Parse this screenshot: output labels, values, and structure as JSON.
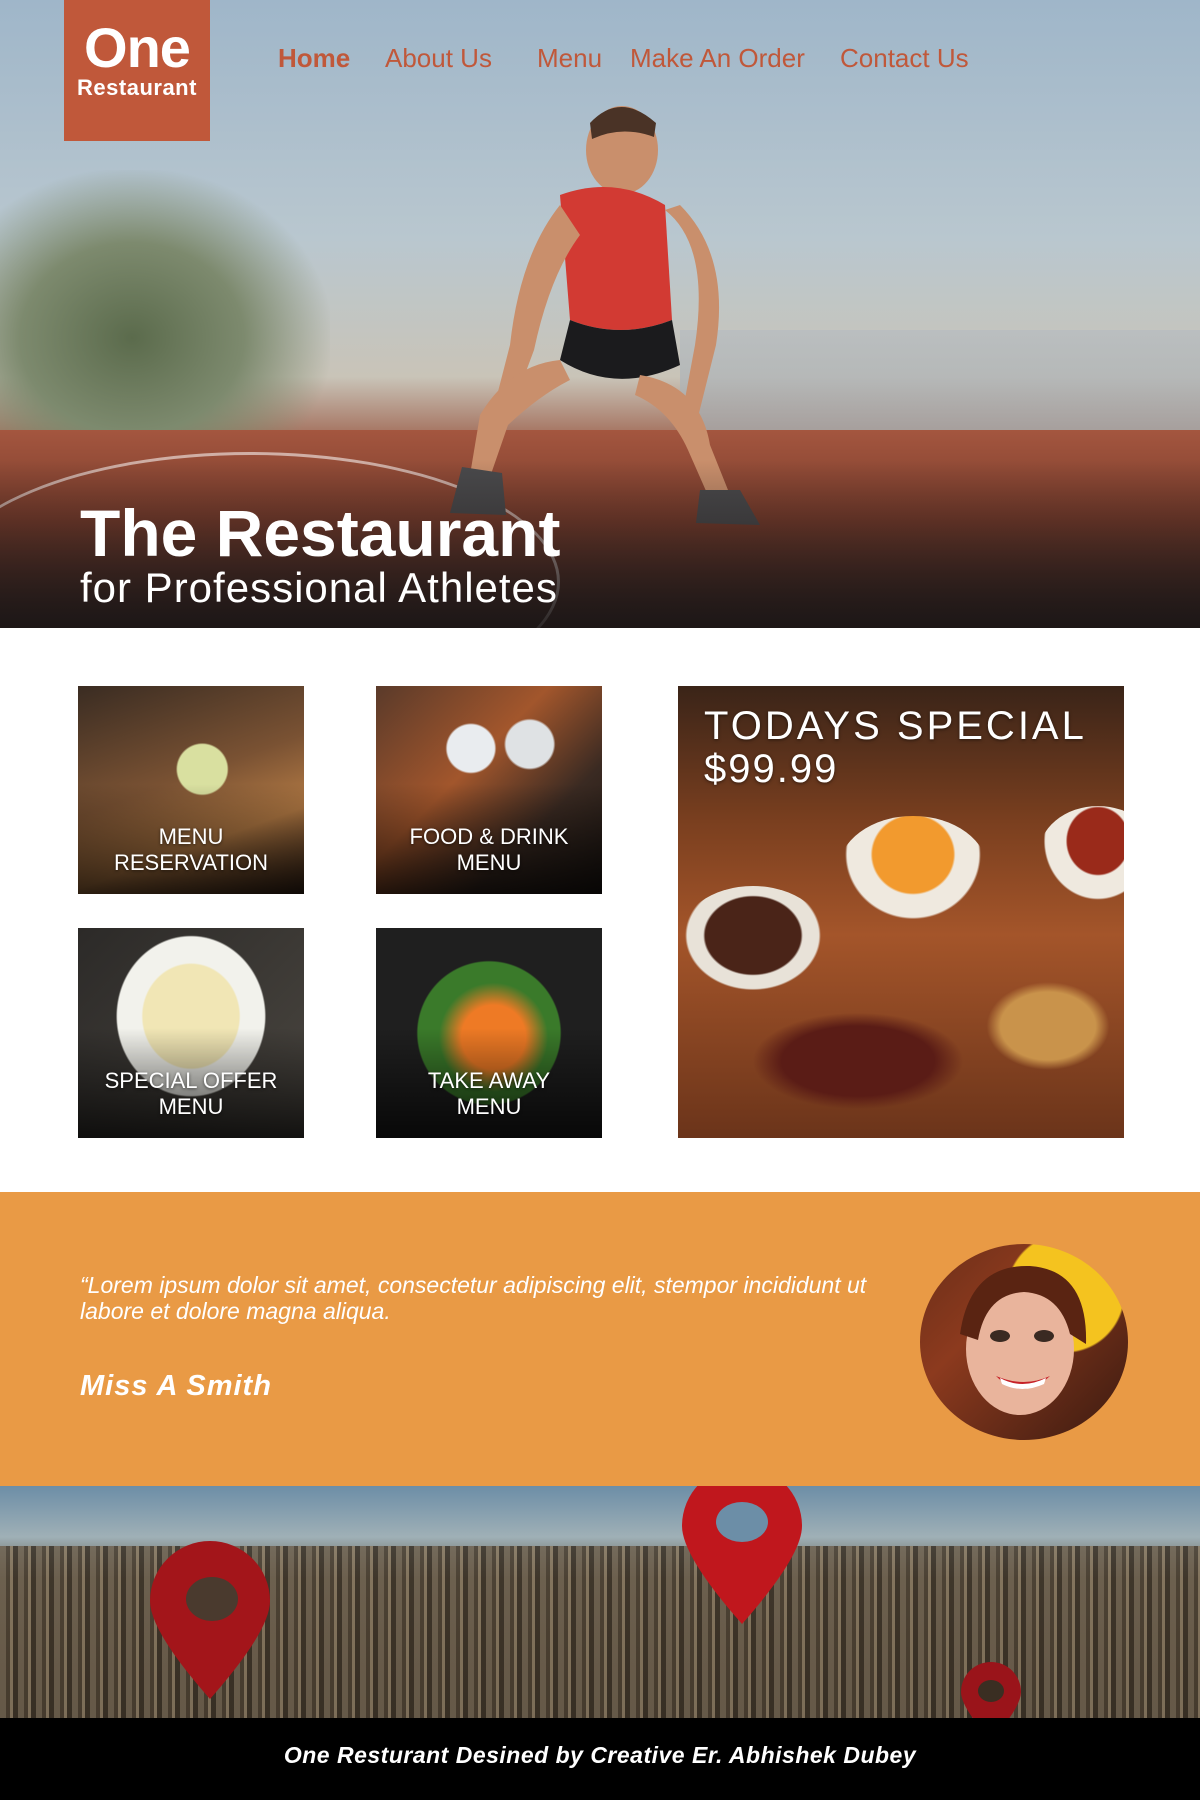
{
  "logo": {
    "line1": "One",
    "line2": "Restaurant"
  },
  "nav": {
    "home": "Home",
    "about": "About Us",
    "menu": "Menu",
    "order": "Make An Order",
    "contact": "Contact Us"
  },
  "hero": {
    "title": "The Restaurant",
    "subtitle": "for Professional Athletes"
  },
  "tiles": [
    {
      "label_line1": "MENU",
      "label_line2": "RESERVATION"
    },
    {
      "label_line1": "FOOD & DRINK",
      "label_line2": "MENU"
    },
    {
      "label_line1": "SPECIAL OFFER",
      "label_line2": "MENU"
    },
    {
      "label_line1": "TAKE AWAY",
      "label_line2": "MENU"
    }
  ],
  "special": {
    "title": "TODAYS SPECIAL",
    "price": "$99.99"
  },
  "testimonial": {
    "quote": "“Lorem ipsum dolor sit amet, consectetur adipiscing elit, stempor incididunt ut labore et dolore magna aliqua.",
    "author": "Miss A Smith"
  },
  "footer": {
    "text": "One Resturant Desined by Creative Er. Abhishek Dubey"
  },
  "colors": {
    "brand": "#c0583a",
    "accent": "#e99a45",
    "footer": "#000000"
  }
}
